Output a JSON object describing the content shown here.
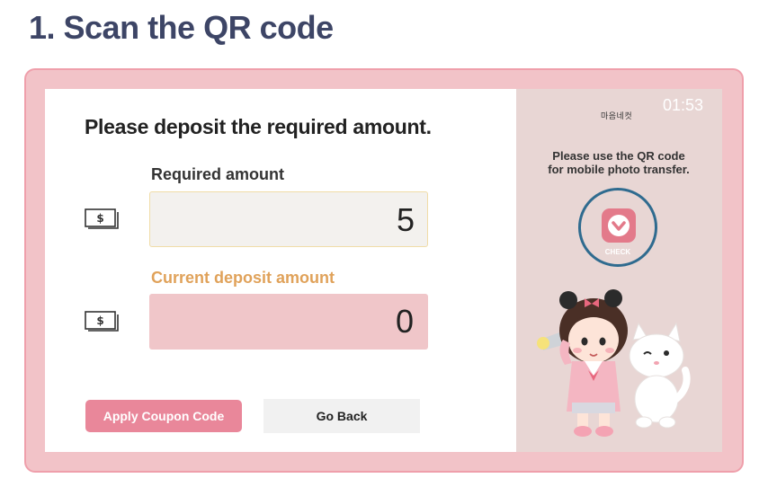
{
  "page": {
    "heading": "1. Scan the QR code"
  },
  "payment": {
    "prompt": "Please deposit the required amount.",
    "required_label": "Required amount",
    "required_value": "5",
    "deposit_label": "Current deposit amount",
    "deposit_value": "0"
  },
  "buttons": {
    "coupon": "Apply Coupon Code",
    "back": "Go Back"
  },
  "side": {
    "brand": "마음네컷",
    "timer": "01:53",
    "qr_note_line1": "Please use the QR code",
    "qr_note_line2": "for mobile photo transfer.",
    "check_label": "CHECK"
  },
  "icons": {
    "bill": "dollar-bill-icon",
    "check": "chevron-down-icon"
  },
  "colors": {
    "frame": "#f2c3c8",
    "coupon_button": "#e9879a",
    "deposit_box": "#f0c6c9",
    "deposit_label": "#e0a25a",
    "check_ring": "#2f6b8f"
  }
}
